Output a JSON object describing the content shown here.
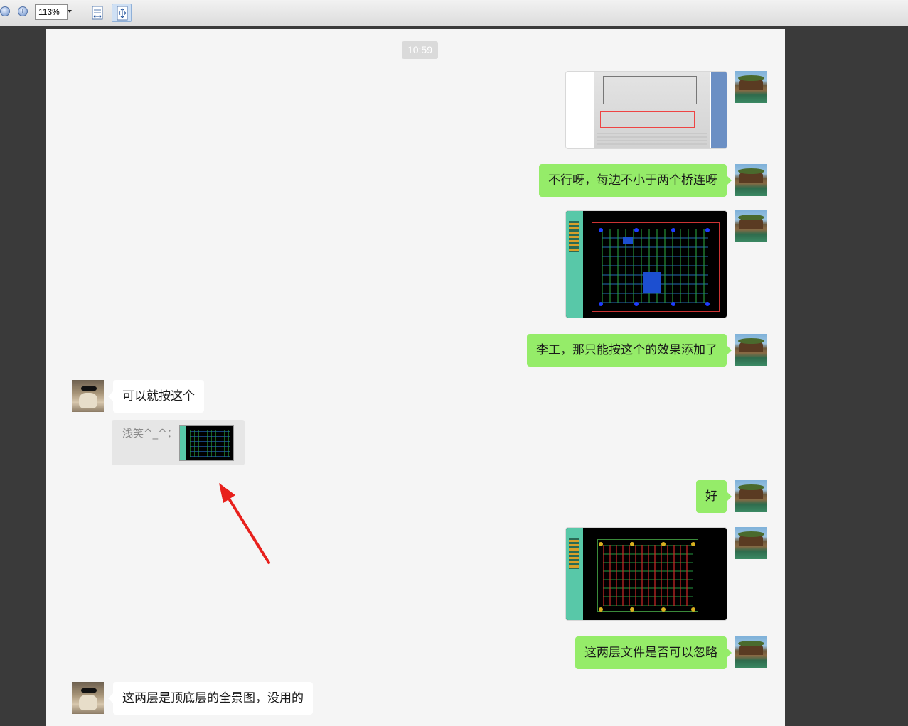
{
  "toolbar": {
    "zoom_value": "113%",
    "zoom_out_icon": "zoom-out-icon",
    "zoom_in_icon": "zoom-in-icon",
    "fit_width_icon": "fit-width-icon",
    "fit_page_icon": "fit-page-icon"
  },
  "chat": {
    "timestamp": "10:59",
    "messages": [
      {
        "side": "me",
        "type": "image",
        "image": "document-photo"
      },
      {
        "side": "me",
        "type": "text",
        "text": "不行呀，每边不小于两个桥连呀"
      },
      {
        "side": "me",
        "type": "image",
        "image": "pcb-layout-blue"
      },
      {
        "side": "me",
        "type": "text",
        "text": "李工，那只能按这个的效果添加了"
      },
      {
        "side": "other",
        "type": "text",
        "text": "可以就按这个"
      },
      {
        "side": "other",
        "type": "quote",
        "quote_text": "浅笑^_^：",
        "image": "pcb-thumbnail"
      },
      {
        "side": "me",
        "type": "text",
        "text": "好"
      },
      {
        "side": "me",
        "type": "image",
        "image": "pcb-layout-red"
      },
      {
        "side": "me",
        "type": "text",
        "text": "这两层文件是否可以忽略"
      },
      {
        "side": "other",
        "type": "text",
        "text": "这两层是顶底层的全景图，没用的"
      }
    ]
  },
  "colors": {
    "my_bubble": "#95ec69",
    "other_bubble": "#ffffff",
    "chat_background": "#f5f5f5",
    "annotation_arrow": "#e8201c"
  }
}
